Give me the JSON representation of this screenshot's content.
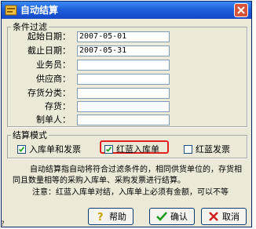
{
  "window": {
    "title": "自动结算"
  },
  "filter_group": {
    "legend": "条件过滤",
    "fields": [
      {
        "label": "起始日期：",
        "value": "2007-05-01"
      },
      {
        "label": "截止日期：",
        "value": "2007-05-31"
      },
      {
        "label": "业务员：",
        "value": ""
      },
      {
        "label": "供应商：",
        "value": ""
      },
      {
        "label": "存货分类：",
        "value": ""
      },
      {
        "label": "存货：",
        "value": ""
      },
      {
        "label": "制单人：",
        "value": ""
      }
    ]
  },
  "mode_group": {
    "legend": "结算模式",
    "options": [
      {
        "label": "入库单和发票",
        "checked": true
      },
      {
        "label": "红蓝入库单",
        "checked": true
      },
      {
        "label": "红蓝发票",
        "checked": false
      }
    ]
  },
  "description": "自动结算指自动将符合过滤条件的，相同供货单位的，存货相同且数量相等的采购入库单、采购发票进行结算。",
  "note": "注意：红蓝入库单对结，入库单上必须有金额，可以不等",
  "buttons": {
    "help": "帮助",
    "ok": "确认",
    "cancel": "取消"
  },
  "corner_mark": "?",
  "colors": {
    "titlebar": "#1f5fdc",
    "highlight": "#e02020",
    "dialog_bg": "#ece9d8"
  }
}
